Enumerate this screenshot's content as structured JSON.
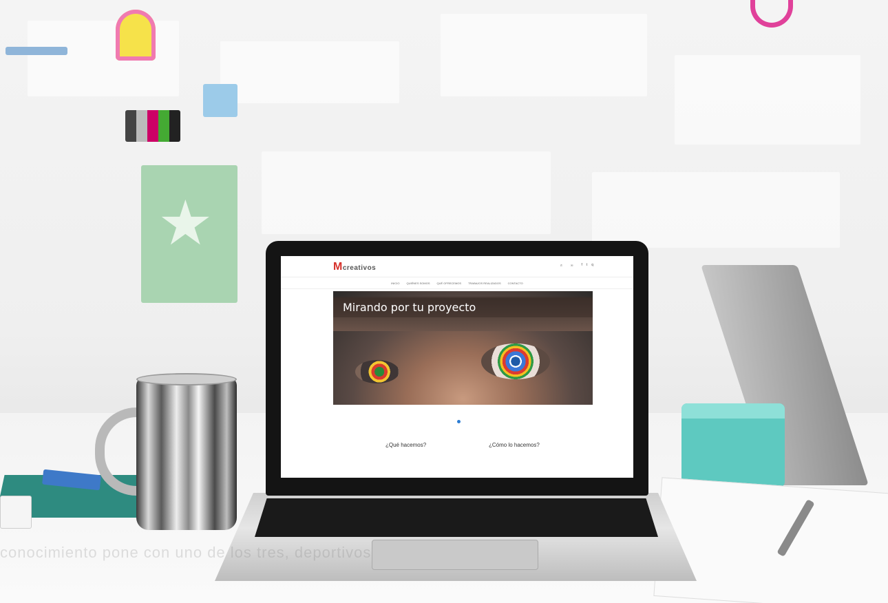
{
  "site": {
    "logo_mark": "M",
    "logo_text": "creativos",
    "logo_subtitle": "",
    "contact_phone": "",
    "contact_email": "",
    "social": [
      "f",
      "t",
      "q"
    ],
    "nav": [
      "INICIO",
      "QUIÉNES SOMOS",
      "QUÉ OFRECEMOS",
      "TRABAJOS REALIZADOS",
      "CONTACTO"
    ],
    "hero_title": "Mirando por tu proyecto",
    "section1_title": "¿Qué hacemos?",
    "section2_title": "¿Cómo lo hacemos?",
    "section1_text": "",
    "section2_text": ""
  },
  "scene": {
    "bottom_caption": "conocimiento pone con uno de los tres, deportivos"
  },
  "colors": {
    "accent_blue": "#2b7cd3",
    "logo_red": "#d6302a",
    "speaker": "#5ec9c0",
    "mat": "#2e8b80"
  }
}
